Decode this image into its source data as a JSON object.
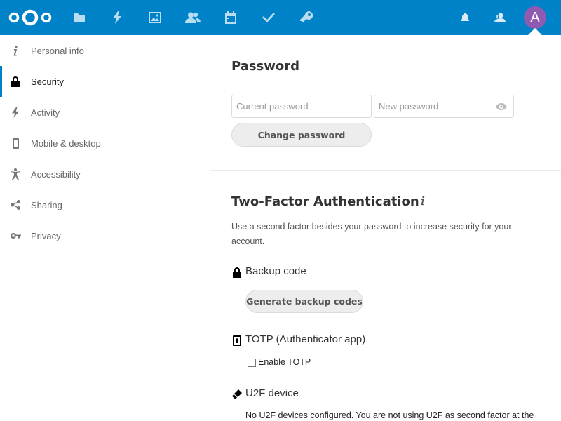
{
  "header": {
    "logo": "nextcloud-logo",
    "apps": [
      {
        "name": "Files",
        "icon": "folder-icon"
      },
      {
        "name": "Activity",
        "icon": "lightning-icon"
      },
      {
        "name": "Gallery",
        "icon": "image-icon"
      },
      {
        "name": "Contacts",
        "icon": "contacts-icon"
      },
      {
        "name": "Calendar",
        "icon": "calendar-icon"
      },
      {
        "name": "Tasks",
        "icon": "checkmark-icon"
      },
      {
        "name": "Passwords",
        "icon": "key-icon"
      }
    ],
    "notifications_icon": "bell-icon",
    "contacts_menu_icon": "contacts-menu-icon",
    "avatar_letter": "A",
    "avatar_color": "#8e5bb0",
    "brand_color": "#0082c9"
  },
  "sidebar": {
    "items": [
      {
        "label": "Personal info",
        "icon": "info-icon",
        "active": false
      },
      {
        "label": "Security",
        "icon": "lock-icon",
        "active": true
      },
      {
        "label": "Activity",
        "icon": "lightning-icon",
        "active": false
      },
      {
        "label": "Mobile & desktop",
        "icon": "phone-icon",
        "active": false
      },
      {
        "label": "Accessibility",
        "icon": "accessibility-icon",
        "active": false
      },
      {
        "label": "Sharing",
        "icon": "share-icon",
        "active": false
      },
      {
        "label": "Privacy",
        "icon": "key-icon",
        "active": false
      }
    ]
  },
  "password": {
    "title": "Password",
    "current_placeholder": "Current password",
    "current_value": "",
    "new_placeholder": "New password",
    "new_value": "",
    "change_button": "Change password"
  },
  "two_factor": {
    "title": "Two-Factor Authentication",
    "description": "Use a second factor besides your password to increase security for your account.",
    "backup": {
      "title": "Backup code",
      "button": "Generate backup codes"
    },
    "totp": {
      "title": "TOTP (Authenticator app)",
      "checkbox_label": "Enable TOTP",
      "checked": false
    },
    "u2f": {
      "title": "U2F device",
      "text": "No U2F devices configured. You are not using U2F as second factor at the"
    }
  }
}
